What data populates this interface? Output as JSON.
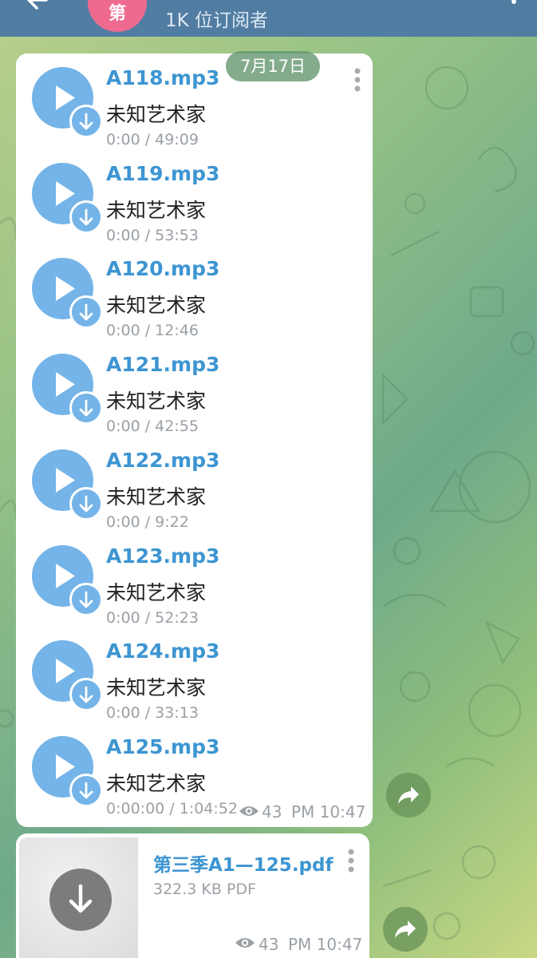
{
  "header": {
    "avatar_letter": "第",
    "subscribers": "1K 位订阅者"
  },
  "date_pill": "7月17日",
  "tracks": [
    {
      "title": "A118.mp3",
      "artist": "未知艺术家",
      "time": "0:00 / 49:09"
    },
    {
      "title": "A119.mp3",
      "artist": "未知艺术家",
      "time": "0:00 / 53:53"
    },
    {
      "title": "A120.mp3",
      "artist": "未知艺术家",
      "time": "0:00 / 12:46"
    },
    {
      "title": "A121.mp3",
      "artist": "未知艺术家",
      "time": "0:00 / 42:55"
    },
    {
      "title": "A122.mp3",
      "artist": "未知艺术家",
      "time": "0:00 / 9:22"
    },
    {
      "title": "A123.mp3",
      "artist": "未知艺术家",
      "time": "0:00 / 52:23"
    },
    {
      "title": "A124.mp3",
      "artist": "未知艺术家",
      "time": "0:00 / 33:13"
    },
    {
      "title": "A125.mp3",
      "artist": "未知艺术家",
      "time": "0:00:00 / 1:04:52"
    }
  ],
  "audio_message": {
    "views": "43",
    "time": "PM 10:47"
  },
  "pdf_message": {
    "filename": "第三季A1—125.pdf",
    "size": "322.3 KB PDF",
    "views": "43",
    "time": "PM 10:47"
  },
  "colors": {
    "header": "#527da3",
    "link_blue": "#3d95d2",
    "play_blue": "#74b4e8",
    "avatar_pink": "#ee6b8f"
  }
}
